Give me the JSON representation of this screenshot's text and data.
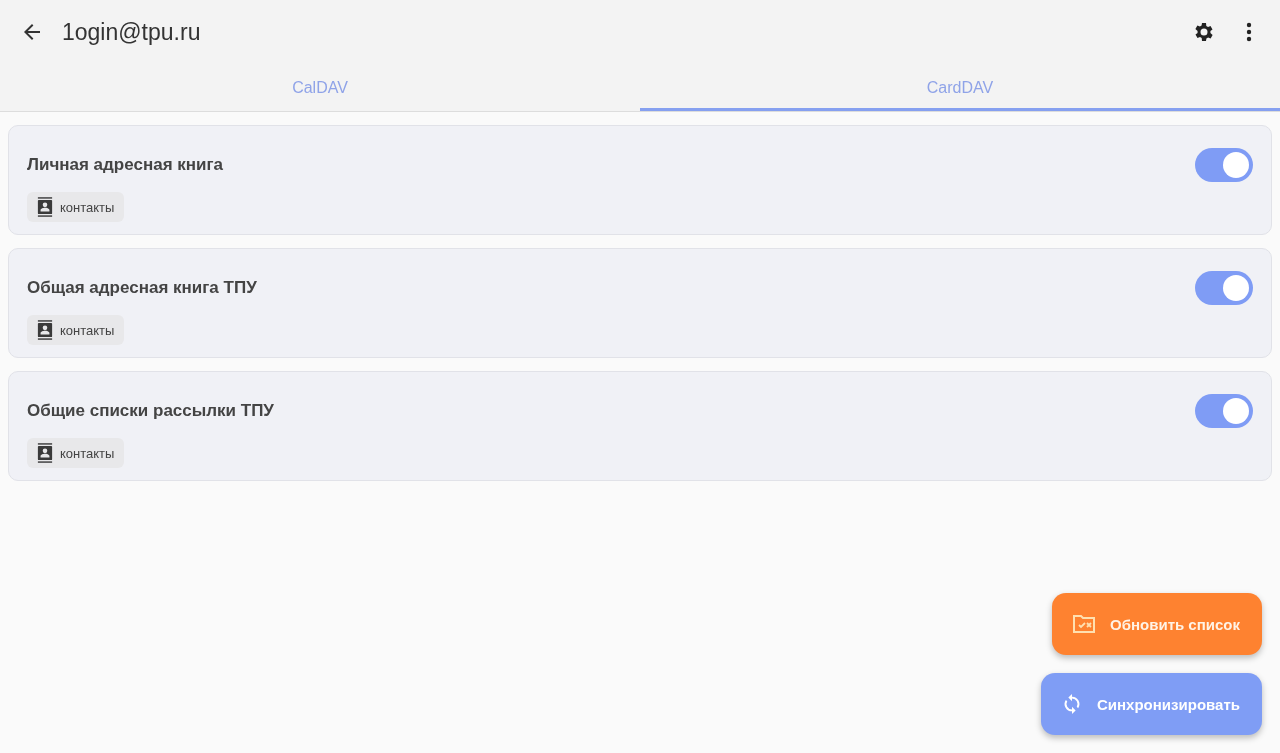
{
  "app_bar": {
    "title": "1ogin@tpu.ru"
  },
  "tabs": [
    {
      "label": "CalDAV",
      "selected": false
    },
    {
      "label": "CardDAV",
      "selected": true
    }
  ],
  "collections": [
    {
      "name": "Личная адресная книга",
      "tag": "контакты",
      "on": true
    },
    {
      "name": "Общая адресная книга ТПУ",
      "tag": "контакты",
      "on": true
    },
    {
      "name": "Общие списки рассылки ТПУ",
      "tag": "контакты",
      "on": true
    }
  ],
  "actions": [
    {
      "kind": "refresh",
      "label": "Обновить список"
    },
    {
      "kind": "sync",
      "label": "Синхронизировать"
    }
  ]
}
